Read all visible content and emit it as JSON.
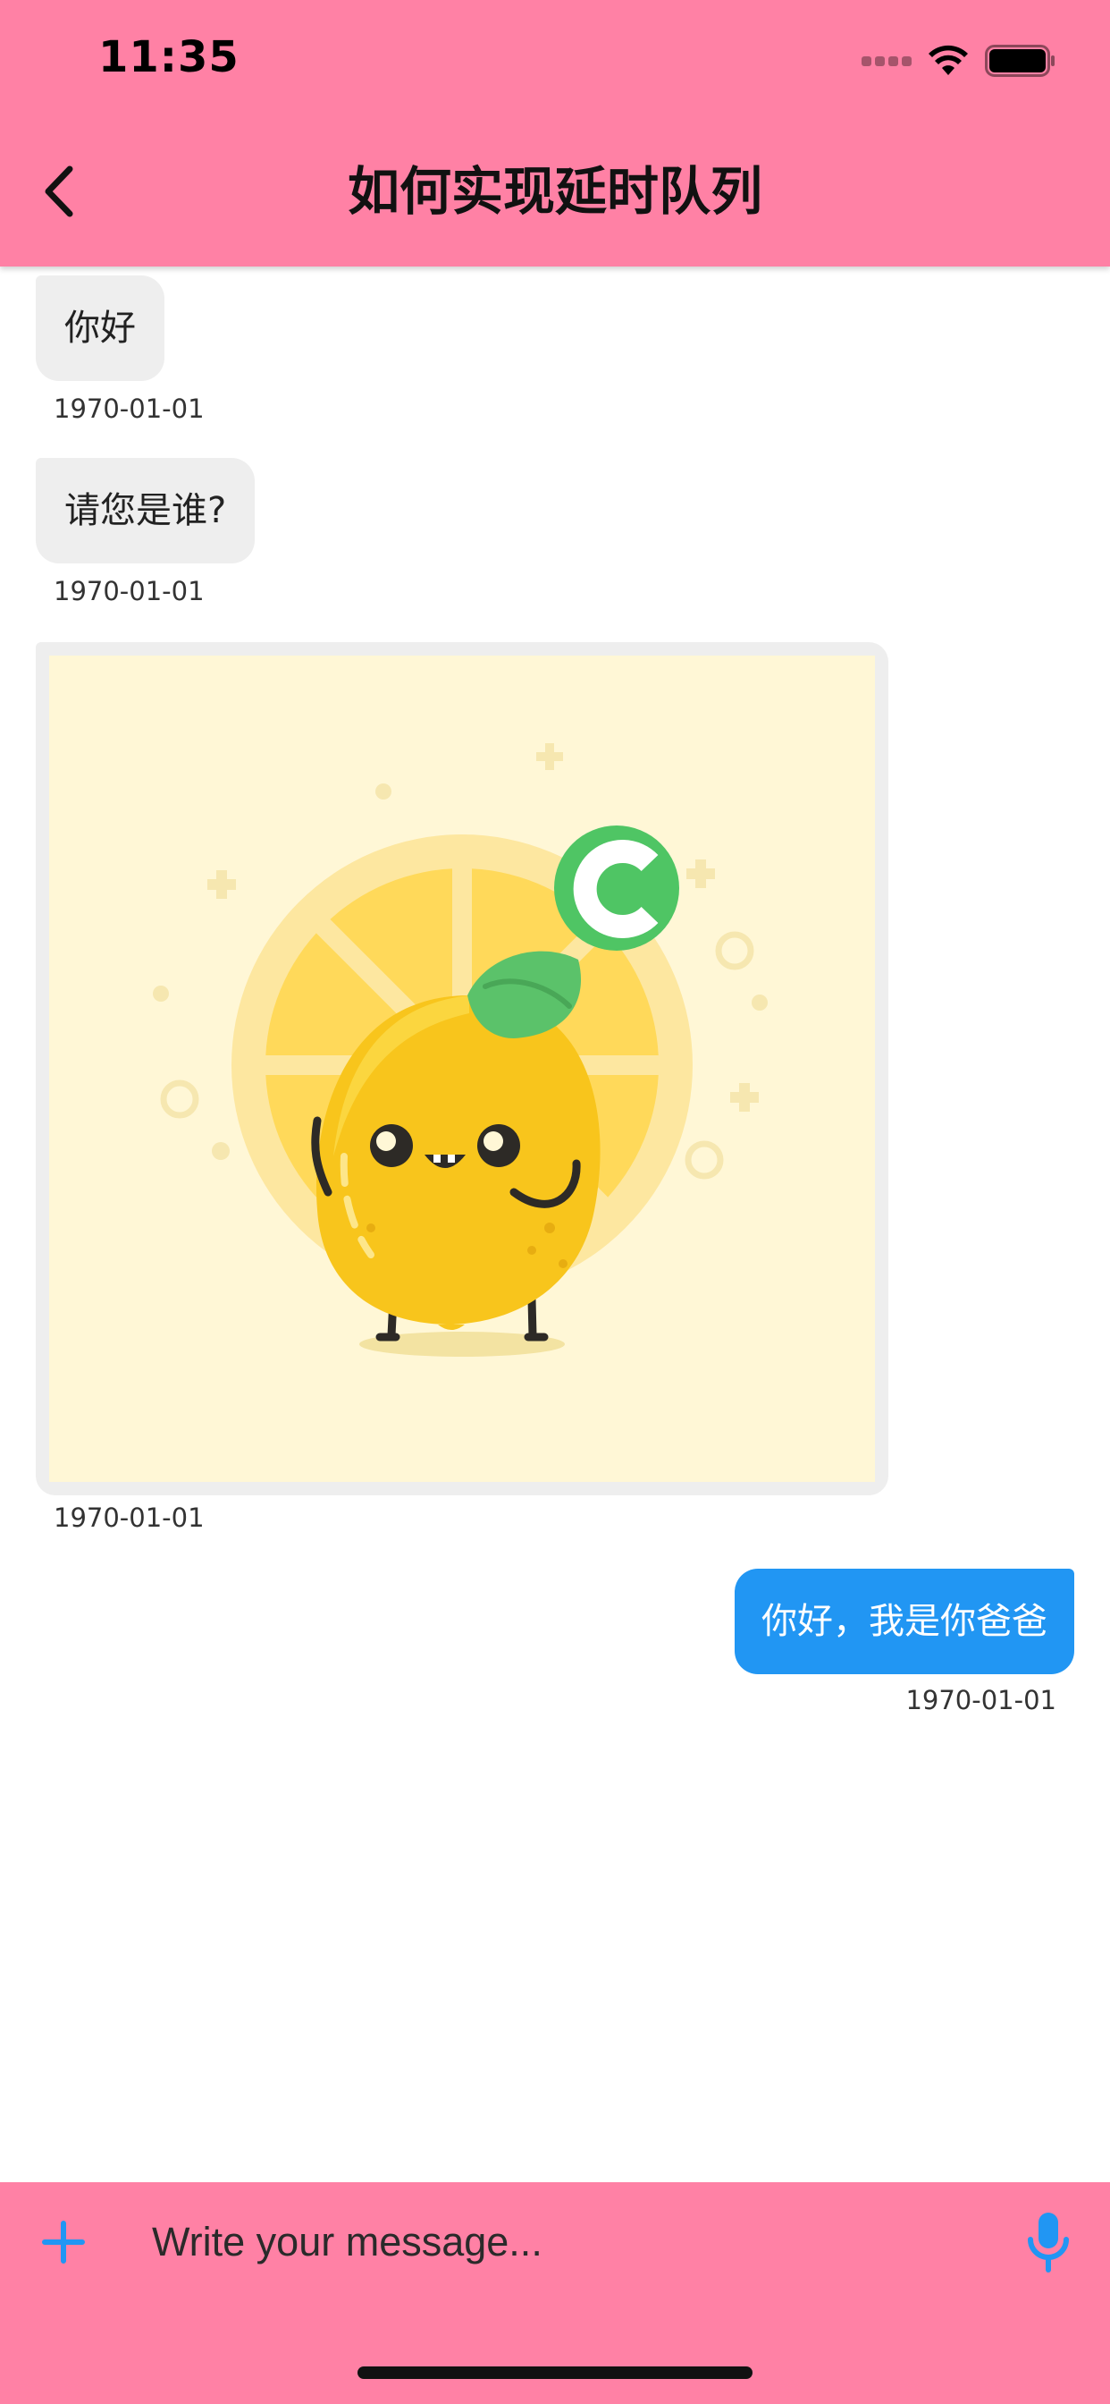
{
  "status_bar": {
    "time": "11:35"
  },
  "header": {
    "title": "如何实现延时队列",
    "background_color": "#ff81a5",
    "back_icon": "chevron-left-icon"
  },
  "messages": [
    {
      "direction": "in",
      "type": "text",
      "text": "你好",
      "time": "1970-01-01"
    },
    {
      "direction": "in",
      "type": "text",
      "text": "请您是谁?",
      "time": "1970-01-01"
    },
    {
      "direction": "in",
      "type": "image",
      "image": "lemon-mascot-illustration",
      "badge_letter": "C",
      "time": "1970-01-01"
    },
    {
      "direction": "out",
      "type": "text",
      "text": "你好，我是你爸爸",
      "time": "1970-01-01"
    }
  ],
  "composer": {
    "placeholder": "Write your message...",
    "add_icon": "plus-icon",
    "mic_icon": "microphone-icon",
    "accent_color": "#2196f3",
    "background_color": "#ff81a5"
  },
  "colors": {
    "incoming_bubble": "#eeeeee",
    "outgoing_bubble": "#2196f3"
  }
}
